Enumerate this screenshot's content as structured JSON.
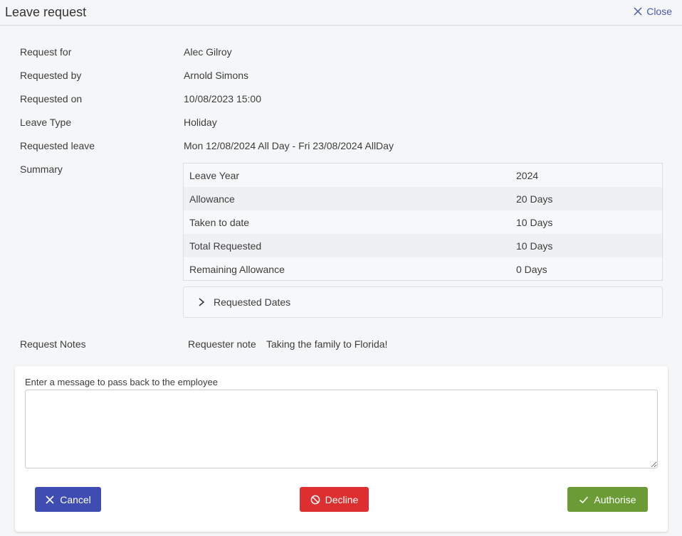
{
  "header": {
    "title": "Leave request",
    "close_label": "Close"
  },
  "details": [
    {
      "label": "Request for",
      "value": "Alec Gilroy"
    },
    {
      "label": "Requested by",
      "value": "Arnold Simons"
    },
    {
      "label": "Requested on",
      "value": "10/08/2023 15:00"
    },
    {
      "label": "Leave Type",
      "value": "Holiday"
    },
    {
      "label": "Requested leave",
      "value": "Mon 12/08/2024 All Day - Fri 23/08/2024 AllDay"
    }
  ],
  "summary": {
    "label": "Summary",
    "rows": [
      {
        "key": "Leave Year",
        "value": "2024"
      },
      {
        "key": "Allowance",
        "value": "20 Days"
      },
      {
        "key": "Taken to date",
        "value": "10 Days"
      },
      {
        "key": "Total Requested",
        "value": "10 Days"
      },
      {
        "key": "Remaining Allowance",
        "value": "0 Days"
      }
    ]
  },
  "requested_dates": {
    "label": "Requested Dates"
  },
  "notes": {
    "label": "Request Notes",
    "requester_label": "Requester note",
    "requester_text": "Taking the family to Florida!"
  },
  "message": {
    "label": "Enter a message to pass back to the employee",
    "value": ""
  },
  "actions": {
    "cancel_label": "Cancel",
    "decline_label": "Decline",
    "authorise_label": "Authorise"
  },
  "colors": {
    "primary": "#3f4db3",
    "danger": "#dd2f2f",
    "success": "#6a9b35",
    "link": "#4a58b0"
  }
}
